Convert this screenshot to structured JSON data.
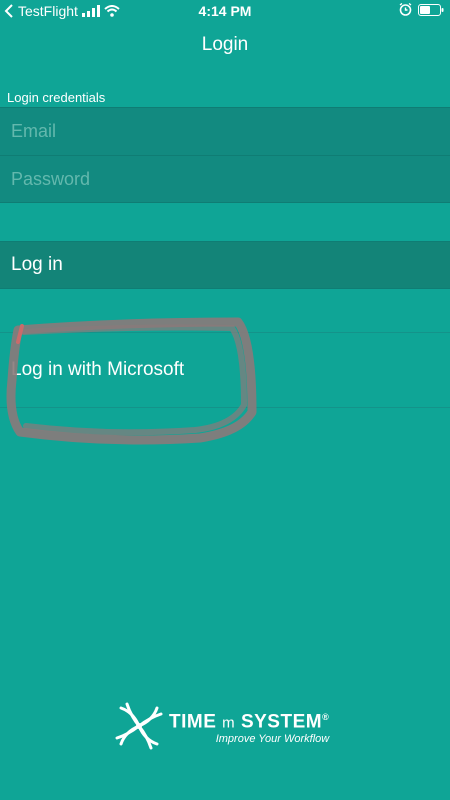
{
  "status_bar": {
    "carrier": "TestFlight",
    "time": "4:14 PM",
    "icons": [
      "back-arrow-icon",
      "signal-icon",
      "wifi-icon",
      "alarm-icon",
      "battery-icon"
    ]
  },
  "nav": {
    "title": "Login"
  },
  "form": {
    "section_label": "Login credentials",
    "email_placeholder": "Email",
    "email_value": "",
    "password_placeholder": "Password",
    "password_value": ""
  },
  "buttons": {
    "login_label": "Log in",
    "microsoft_label": "Log in with Microsoft"
  },
  "logo": {
    "brand_time": "TIME",
    "brand_m": "m",
    "brand_system": "SYSTEM",
    "registered": "®",
    "tagline": "Improve Your Workflow"
  },
  "colors": {
    "background": "#0fa596",
    "field_background": "#128a80",
    "button_background": "#138478",
    "annotation": "#8a7a7a"
  }
}
